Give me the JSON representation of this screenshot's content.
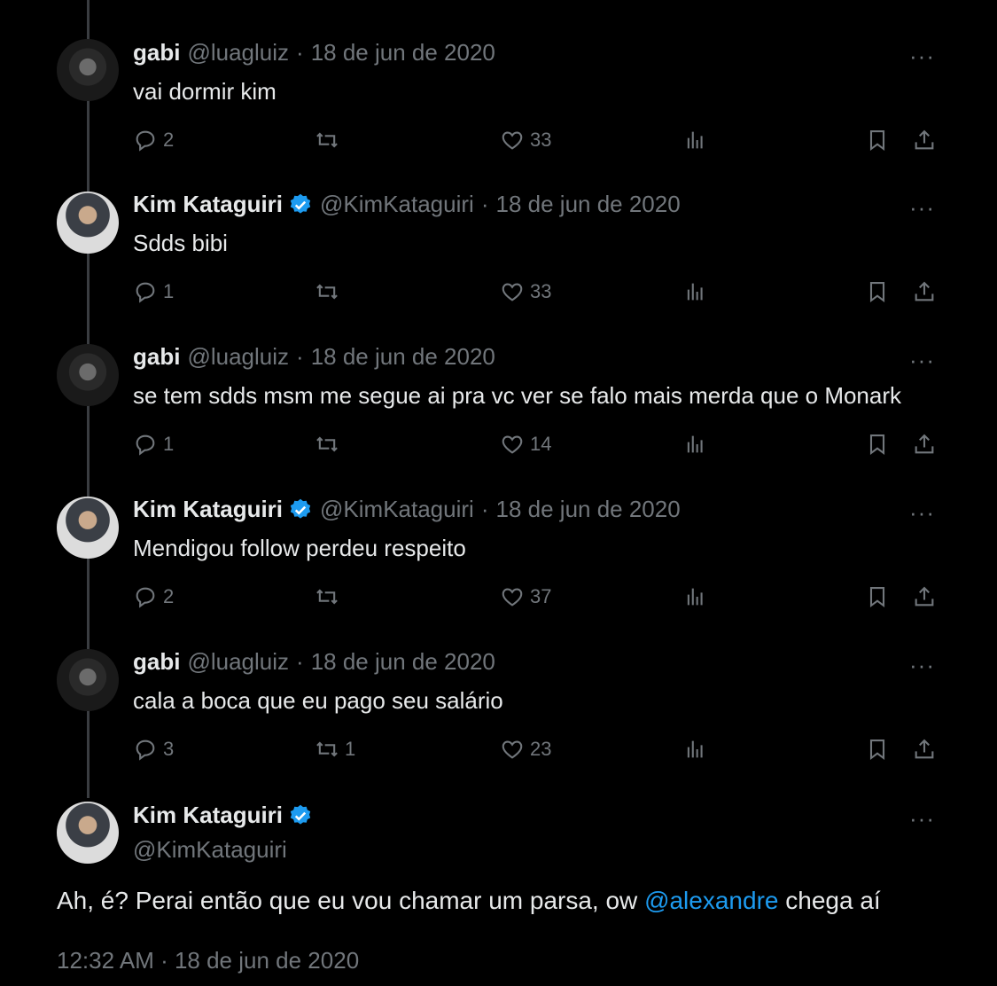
{
  "replies": [
    {
      "name": "gabi",
      "handle": "@luagluiz",
      "sep": "·",
      "date": "18 de jun de 2020",
      "verified": false,
      "avatar": "gabi",
      "text": "vai dormir kim",
      "replies": "2",
      "retweets": "",
      "likes": "33"
    },
    {
      "name": "Kim Kataguiri",
      "handle": "@KimKataguiri",
      "sep": "·",
      "date": "18 de jun de 2020",
      "verified": true,
      "avatar": "kim",
      "text": "Sdds bibi",
      "replies": "1",
      "retweets": "",
      "likes": "33"
    },
    {
      "name": "gabi",
      "handle": "@luagluiz",
      "sep": "·",
      "date": "18 de jun de 2020",
      "verified": false,
      "avatar": "gabi",
      "text": "se tem sdds msm me segue ai pra vc ver se falo mais merda que o Monark",
      "replies": "1",
      "retweets": "",
      "likes": "14"
    },
    {
      "name": "Kim Kataguiri",
      "handle": "@KimKataguiri",
      "sep": "·",
      "date": "18 de jun de 2020",
      "verified": true,
      "avatar": "kim",
      "text": "Mendigou follow perdeu respeito",
      "replies": "2",
      "retweets": "",
      "likes": "37"
    },
    {
      "name": "gabi",
      "handle": "@luagluiz",
      "sep": "·",
      "date": "18 de jun de 2020",
      "verified": false,
      "avatar": "gabi",
      "text": "cala a boca que eu pago seu salário",
      "replies": "3",
      "retweets": "1",
      "likes": "23"
    }
  ],
  "main": {
    "name": "Kim Kataguiri",
    "handle": "@KimKataguiri",
    "text_before": "Ah, é? Perai então que eu vou chamar um parsa, ow ",
    "mention": "@alexandre",
    "text_after": " chega aí",
    "timestamp": "12:32 AM · 18 de jun de 2020"
  },
  "more_label": "···",
  "colors": {
    "background": "#000000",
    "text": "#e7e9ea",
    "muted": "#71767b",
    "accent": "#1d9bf0"
  },
  "icons": [
    "reply-icon",
    "retweet-icon",
    "like-icon",
    "views-icon",
    "bookmark-icon",
    "share-icon",
    "verified-badge-icon",
    "more-icon"
  ]
}
